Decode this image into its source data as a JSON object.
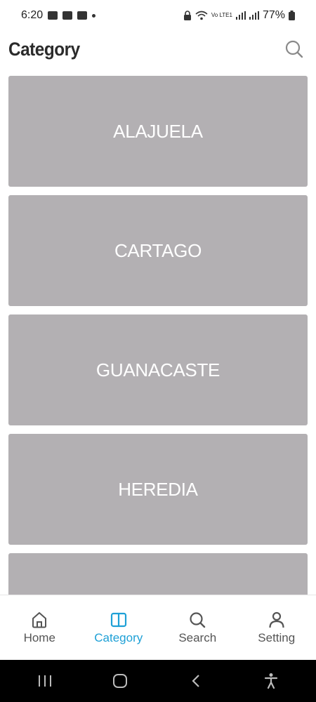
{
  "status_bar": {
    "time": "6:20",
    "network_label": "Vo LTE1",
    "battery": "77%"
  },
  "header": {
    "title": "Category"
  },
  "categories": [
    {
      "label": "ALAJUELA"
    },
    {
      "label": "CARTAGO"
    },
    {
      "label": "GUANACASTE"
    },
    {
      "label": "HEREDIA"
    },
    {
      "label": ""
    }
  ],
  "bottom_nav": {
    "items": [
      {
        "label": "Home",
        "icon": "home-icon"
      },
      {
        "label": "Category",
        "icon": "book-icon",
        "active": true
      },
      {
        "label": "Search",
        "icon": "search-icon"
      },
      {
        "label": "Setting",
        "icon": "person-icon"
      }
    ]
  },
  "colors": {
    "accent": "#1ea0d6",
    "card": "#b3b0b3",
    "nav_inactive": "#555555"
  }
}
